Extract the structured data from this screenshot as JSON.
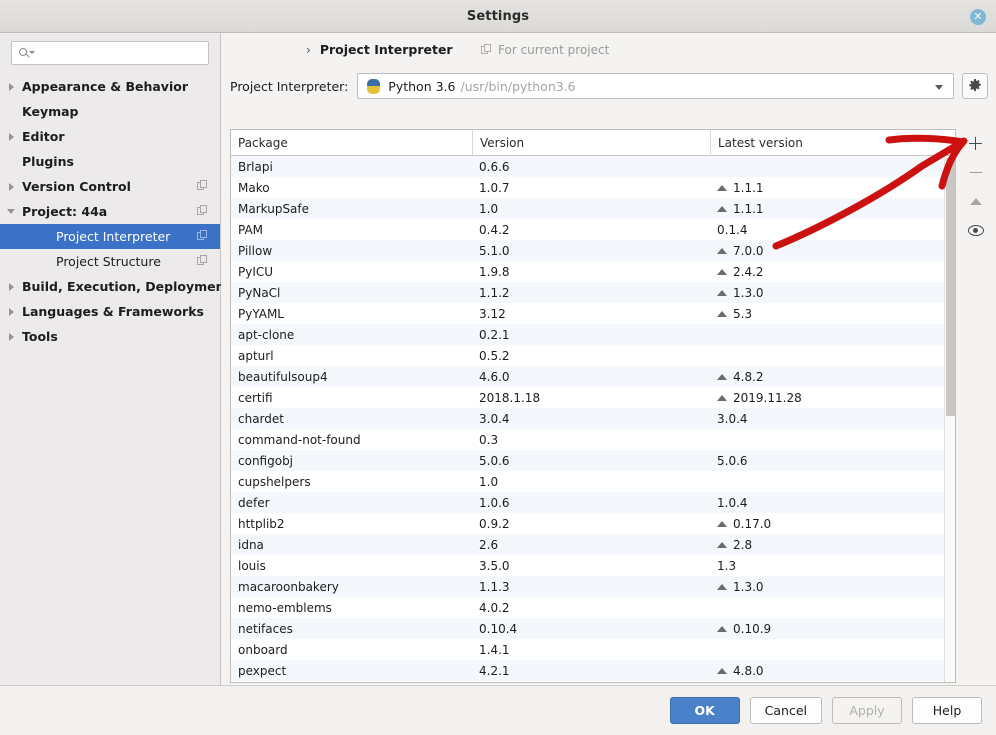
{
  "window": {
    "title": "Settings",
    "close_icon": "close-icon"
  },
  "sidebar": {
    "search": {
      "value": "",
      "placeholder": ""
    },
    "items": [
      {
        "label": "Appearance & Behavior",
        "twisty": "right",
        "bold": true,
        "indent": false,
        "module_icon": false,
        "selected": false
      },
      {
        "label": "Keymap",
        "twisty": "none",
        "bold": true,
        "indent": false,
        "module_icon": false,
        "selected": false
      },
      {
        "label": "Editor",
        "twisty": "right",
        "bold": true,
        "indent": false,
        "module_icon": false,
        "selected": false
      },
      {
        "label": "Plugins",
        "twisty": "none",
        "bold": true,
        "indent": false,
        "module_icon": false,
        "selected": false
      },
      {
        "label": "Version Control",
        "twisty": "right",
        "bold": true,
        "indent": false,
        "module_icon": true,
        "selected": false
      },
      {
        "label": "Project: 44a",
        "twisty": "down",
        "bold": true,
        "indent": false,
        "module_icon": true,
        "selected": false
      },
      {
        "label": "Project Interpreter",
        "twisty": "none",
        "bold": false,
        "indent": true,
        "module_icon": true,
        "selected": true
      },
      {
        "label": "Project Structure",
        "twisty": "none",
        "bold": false,
        "indent": true,
        "module_icon": true,
        "selected": false
      },
      {
        "label": "Build, Execution, Deployment",
        "twisty": "right",
        "bold": true,
        "indent": false,
        "module_icon": false,
        "selected": false
      },
      {
        "label": "Languages & Frameworks",
        "twisty": "right",
        "bold": true,
        "indent": false,
        "module_icon": false,
        "selected": false
      },
      {
        "label": "Tools",
        "twisty": "right",
        "bold": true,
        "indent": false,
        "module_icon": false,
        "selected": false
      }
    ]
  },
  "main": {
    "breadcrumb_title": "Project Interpreter",
    "scope_label": "For current project",
    "interpreter_label": "Project Interpreter:",
    "interpreter_name": "Python 3.6",
    "interpreter_path": "/usr/bin/python3.6",
    "gear_icon": "gear-icon"
  },
  "table": {
    "columns": [
      "Package",
      "Version",
      "Latest version"
    ],
    "rows": [
      {
        "package": "Brlapi",
        "version": "0.6.6",
        "latest": "",
        "upgradable": false
      },
      {
        "package": "Mako",
        "version": "1.0.7",
        "latest": "1.1.1",
        "upgradable": true
      },
      {
        "package": "MarkupSafe",
        "version": "1.0",
        "latest": "1.1.1",
        "upgradable": true
      },
      {
        "package": "PAM",
        "version": "0.4.2",
        "latest": "0.1.4",
        "upgradable": false
      },
      {
        "package": "Pillow",
        "version": "5.1.0",
        "latest": "7.0.0",
        "upgradable": true
      },
      {
        "package": "PyICU",
        "version": "1.9.8",
        "latest": "2.4.2",
        "upgradable": true
      },
      {
        "package": "PyNaCl",
        "version": "1.1.2",
        "latest": "1.3.0",
        "upgradable": true
      },
      {
        "package": "PyYAML",
        "version": "3.12",
        "latest": "5.3",
        "upgradable": true
      },
      {
        "package": "apt-clone",
        "version": "0.2.1",
        "latest": "",
        "upgradable": false
      },
      {
        "package": "apturl",
        "version": "0.5.2",
        "latest": "",
        "upgradable": false
      },
      {
        "package": "beautifulsoup4",
        "version": "4.6.0",
        "latest": "4.8.2",
        "upgradable": true
      },
      {
        "package": "certifi",
        "version": "2018.1.18",
        "latest": "2019.11.28",
        "upgradable": true
      },
      {
        "package": "chardet",
        "version": "3.0.4",
        "latest": "3.0.4",
        "upgradable": false
      },
      {
        "package": "command-not-found",
        "version": "0.3",
        "latest": "",
        "upgradable": false
      },
      {
        "package": "configobj",
        "version": "5.0.6",
        "latest": "5.0.6",
        "upgradable": false
      },
      {
        "package": "cupshelpers",
        "version": "1.0",
        "latest": "",
        "upgradable": false
      },
      {
        "package": "defer",
        "version": "1.0.6",
        "latest": "1.0.4",
        "upgradable": false
      },
      {
        "package": "httplib2",
        "version": "0.9.2",
        "latest": "0.17.0",
        "upgradable": true
      },
      {
        "package": "idna",
        "version": "2.6",
        "latest": "2.8",
        "upgradable": true
      },
      {
        "package": "louis",
        "version": "3.5.0",
        "latest": "1.3",
        "upgradable": false
      },
      {
        "package": "macaroonbakery",
        "version": "1.1.3",
        "latest": "1.3.0",
        "upgradable": true
      },
      {
        "package": "nemo-emblems",
        "version": "4.0.2",
        "latest": "",
        "upgradable": false
      },
      {
        "package": "netifaces",
        "version": "0.10.4",
        "latest": "0.10.9",
        "upgradable": true
      },
      {
        "package": "onboard",
        "version": "1.4.1",
        "latest": "",
        "upgradable": false
      },
      {
        "package": "pexpect",
        "version": "4.2.1",
        "latest": "4.8.0",
        "upgradable": true
      }
    ]
  },
  "side_tools": [
    {
      "name": "add-package-button",
      "icon": "plus-icon",
      "enabled": true
    },
    {
      "name": "remove-package-button",
      "icon": "minus-icon",
      "enabled": false
    },
    {
      "name": "upgrade-package-button",
      "icon": "arrow-up-icon",
      "enabled": false
    },
    {
      "name": "show-early-releases-button",
      "icon": "eye-icon",
      "enabled": true
    }
  ],
  "footer": {
    "ok": "OK",
    "cancel": "Cancel",
    "apply": "Apply",
    "help": "Help"
  },
  "annotation": {
    "type": "red-arrow",
    "color": "#cc1111",
    "points_to": "add-package-button"
  }
}
